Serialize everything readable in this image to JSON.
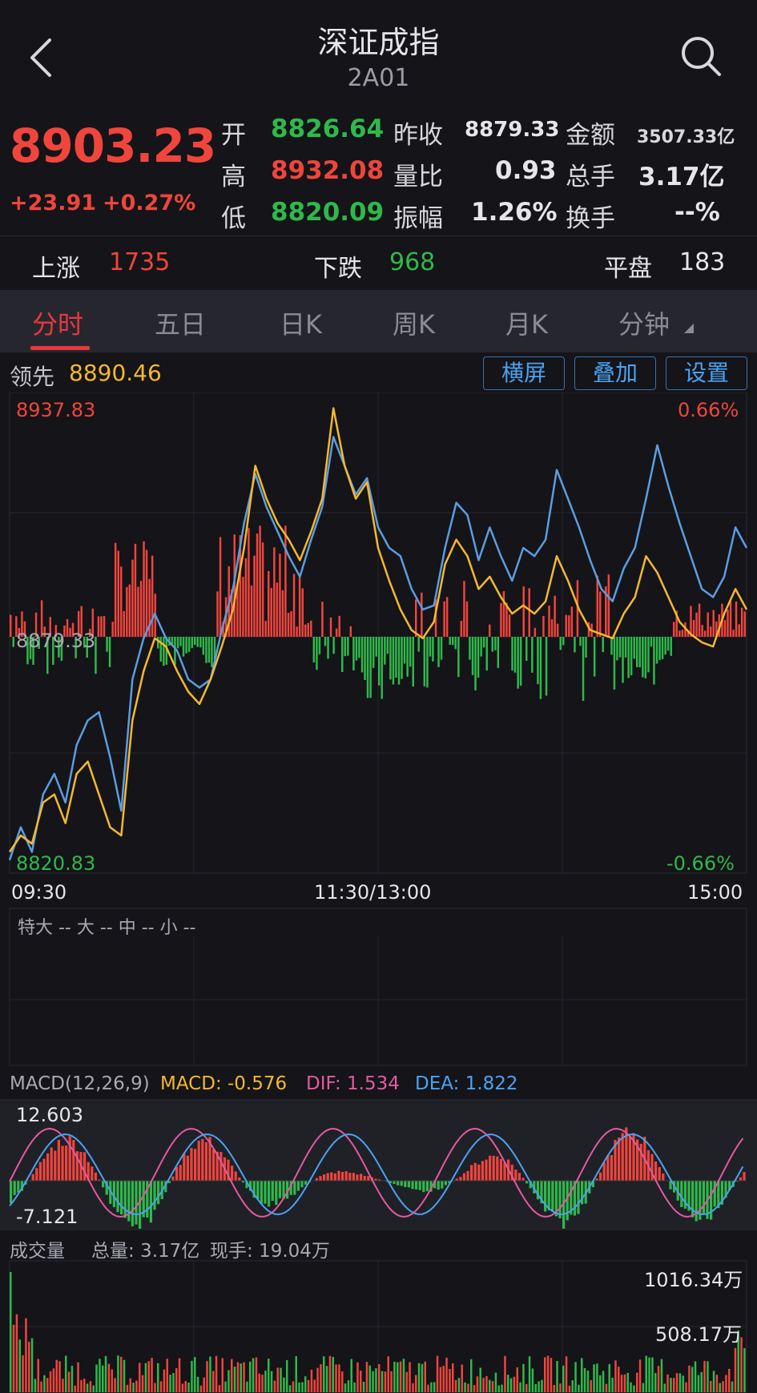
{
  "header": {
    "title": "深证成指",
    "subtitle": "2A01"
  },
  "quote": {
    "price": "8903.23",
    "change": "+23.91",
    "change_pct": "+0.27%",
    "rows": [
      {
        "l1": "开",
        "v1": "8826.64",
        "l2": "昨收",
        "v2": "8879.33",
        "l3": "金额",
        "v3": "3507.33亿"
      },
      {
        "l1": "高",
        "v1": "8932.08",
        "l2": "量比",
        "v2": "0.93",
        "l3": "总手",
        "v3": "3.17亿"
      },
      {
        "l1": "低",
        "v1": "8820.09",
        "l2": "振幅",
        "v2": "1.26%",
        "l3": "换手",
        "v3": "--%"
      }
    ]
  },
  "breadth": {
    "up_label": "上涨",
    "up_value": "1735",
    "down_label": "下跌",
    "down_value": "968",
    "flat_label": "平盘",
    "flat_value": "183"
  },
  "tabs": [
    {
      "label": "分时",
      "active": true
    },
    {
      "label": "五日"
    },
    {
      "label": "日K"
    },
    {
      "label": "周K"
    },
    {
      "label": "月K"
    },
    {
      "label": "分钟"
    }
  ],
  "lead": {
    "label": "领先",
    "value": "8890.46"
  },
  "buttons": {
    "landscape": "横屏",
    "overlay": "叠加",
    "settings": "设置"
  },
  "intraday": {
    "y_max": "8937.83",
    "y_mid": "8879.33",
    "y_min": "8820.83",
    "pct_max": "0.66%",
    "pct_min": "-0.66%",
    "x_start": "09:30",
    "x_mid": "11:30/13:00",
    "x_end": "15:00"
  },
  "fund_flow": {
    "text": "特大 --  大 --  中 --  小 --"
  },
  "macd": {
    "title": "MACD(12,26,9)",
    "macd_label": "MACD: -0.576",
    "dif_label": "DIF: 1.534",
    "dea_label": "DEA: 1.822",
    "y_max": "12.603",
    "y_min": "-7.121"
  },
  "volume": {
    "title": "成交量",
    "total": "总量: 3.17亿",
    "current": "现手: 19.04万",
    "y_max": "1016.34万",
    "y_mid": "508.17万"
  },
  "colors": {
    "up": "#f0453c",
    "down": "#2fb94a",
    "price_line": "#5b9de0",
    "avg_line": "#f5b82e",
    "dif_line": "#e35aa0",
    "dea_line": "#4aa3f2"
  },
  "chart_data": {
    "type": "line",
    "series": [
      {
        "values": [
          8824,
          8832,
          8826,
          8840,
          8845,
          8838,
          8852,
          8858,
          8860,
          8849,
          8836,
          8868,
          8878,
          8884,
          8878,
          8875,
          8868,
          8866,
          8868,
          8880,
          8890,
          8906,
          8918,
          8910,
          8904,
          8898,
          8893,
          8902,
          8910,
          8927,
          8920,
          8913,
          8917,
          8905,
          8900,
          8898,
          8890,
          8885,
          8886,
          8900,
          8911,
          8908,
          8897,
          8905,
          8898,
          8892,
          8900,
          8898,
          8902,
          8919,
          8912,
          8905,
          8897,
          8890,
          8887,
          8895,
          8900,
          8912,
          8925,
          8915,
          8906,
          8898,
          8890,
          8888,
          8893,
          8905,
          8900
        ]
      },
      {
        "values": [
          8826,
          8830,
          8828,
          8838,
          8840,
          8833,
          8845,
          8848,
          8840,
          8832,
          8830,
          8858,
          8870,
          8878,
          8876,
          8870,
          8865,
          8862,
          8868,
          8876,
          8885,
          8900,
          8920,
          8912,
          8906,
          8902,
          8897,
          8904,
          8912,
          8934,
          8920,
          8912,
          8916,
          8900,
          8892,
          8885,
          8880,
          8878,
          8882,
          8896,
          8902,
          8898,
          8890,
          8893,
          8888,
          8884,
          8886,
          8884,
          8887,
          8898,
          8892,
          8885,
          8880,
          8879,
          8878,
          8884,
          8888,
          8898,
          8894,
          8888,
          8882,
          8879,
          8877,
          8876,
          8884,
          8890,
          8885
        ]
      }
    ],
    "ylim": [
      8820.83,
      8937.83
    ]
  }
}
